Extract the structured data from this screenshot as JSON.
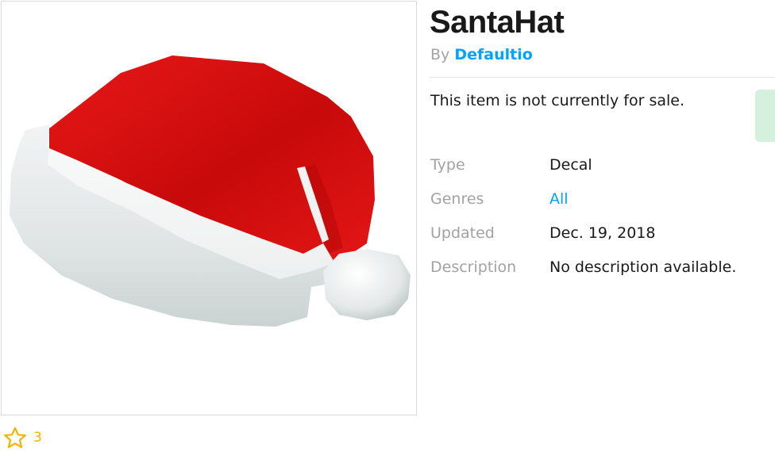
{
  "item": {
    "title": "SantaHat",
    "by_prefix": "By",
    "creator": "Defaultio",
    "sale_status": "This item is not currently for sale.",
    "favorites_count": "3"
  },
  "details": [
    {
      "label": "Type",
      "value": "Decal"
    },
    {
      "label": "Genres",
      "value": "All"
    },
    {
      "label": "Updated",
      "value": "Dec. 19, 2018"
    },
    {
      "label": "Description",
      "value": "No description available."
    }
  ],
  "icons": {
    "favorite": "star-outline-icon"
  },
  "colors": {
    "link": "#00a2ff",
    "label": "#a2a2a2",
    "star": "#f2b400",
    "buy_button": "#d6f0de"
  }
}
